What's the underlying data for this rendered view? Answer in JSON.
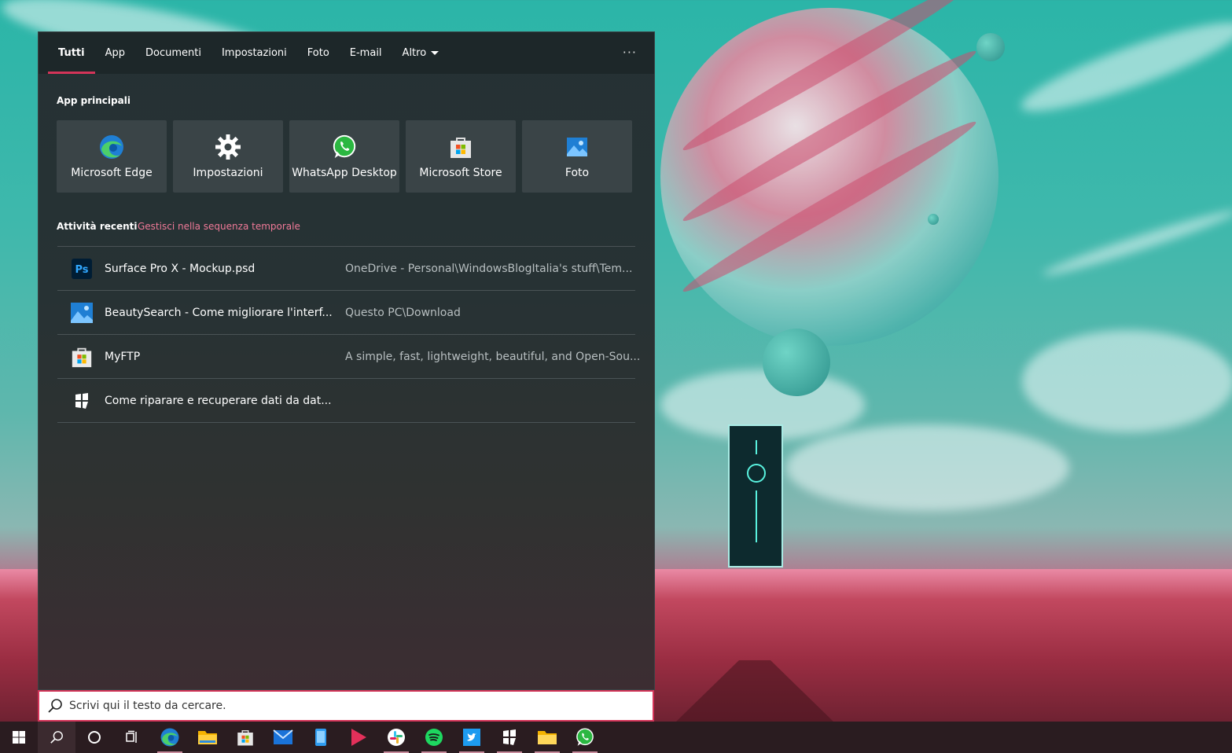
{
  "tabs": [
    {
      "label": "Tutti",
      "active": true
    },
    {
      "label": "App"
    },
    {
      "label": "Documenti"
    },
    {
      "label": "Impostazioni"
    },
    {
      "label": "Foto"
    },
    {
      "label": "E-mail"
    },
    {
      "label": "Altro"
    }
  ],
  "more_label": "···",
  "top_apps": {
    "title": "App principali",
    "items": [
      {
        "label": "Microsoft Edge",
        "icon": "edge-icon"
      },
      {
        "label": "Impostazioni",
        "icon": "gear-icon"
      },
      {
        "label": "WhatsApp Desktop",
        "icon": "whatsapp-icon"
      },
      {
        "label": "Microsoft Store",
        "icon": "store-icon"
      },
      {
        "label": "Foto",
        "icon": "photos-icon"
      }
    ]
  },
  "recent": {
    "title": "Attività recenti",
    "manage_link": "Gestisci nella sequenza temporale",
    "items": [
      {
        "name": "Surface Pro X - Mockup.psd",
        "path": "OneDrive - Personal\\WindowsBlogItalia's stuff\\Tem...",
        "icon": "photoshop-icon"
      },
      {
        "name": "BeautySearch - Come migliorare l'interf...",
        "path": "Questo PC\\Download",
        "icon": "photos-icon"
      },
      {
        "name": "MyFTP",
        "path": "A simple, fast, lightweight, beautiful, and Open-Sou...",
        "icon": "store-icon"
      },
      {
        "name": "Come riparare e recuperare dati da dat...",
        "path": "",
        "icon": "windowsblog-icon"
      }
    ]
  },
  "search": {
    "placeholder": "Scrivi qui il testo da cercare."
  },
  "colors": {
    "accent": "#d43459",
    "link": "#f07a98",
    "panel": "#263133",
    "taskbar": "#2a1c20"
  }
}
